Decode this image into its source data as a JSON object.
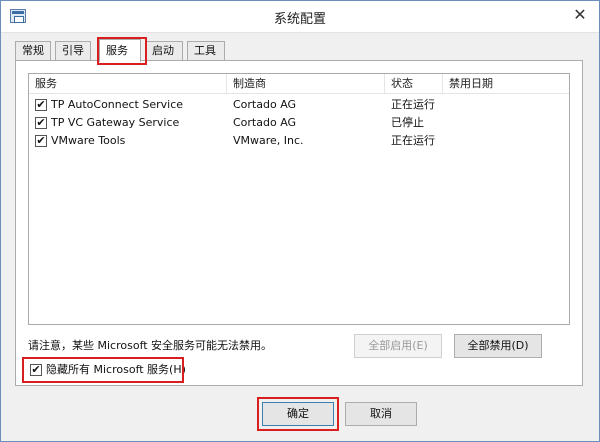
{
  "window": {
    "title": "系统配置"
  },
  "tabs": [
    {
      "label": "常规",
      "active": false
    },
    {
      "label": "引导",
      "active": false
    },
    {
      "label": "服务",
      "active": true
    },
    {
      "label": "启动",
      "active": false
    },
    {
      "label": "工具",
      "active": false
    }
  ],
  "services": {
    "columns": [
      "服务",
      "制造商",
      "状态",
      "禁用日期"
    ],
    "rows": [
      {
        "checked": true,
        "service": "TP AutoConnect Service",
        "manufacturer": "Cortado AG",
        "status": "正在运行",
        "disabled_date": ""
      },
      {
        "checked": true,
        "service": "TP VC Gateway Service",
        "manufacturer": "Cortado AG",
        "status": "已停止",
        "disabled_date": ""
      },
      {
        "checked": true,
        "service": "VMware Tools",
        "manufacturer": "VMware, Inc.",
        "status": "正在运行",
        "disabled_date": ""
      }
    ]
  },
  "note": "请注意，某些 Microsoft 安全服务可能无法禁用。",
  "buttons": {
    "enable_all": "全部启用(E)",
    "disable_all": "全部禁用(D)",
    "ok": "确定",
    "cancel": "取消"
  },
  "hide_ms": {
    "label": "隐藏所有 Microsoft 服务(H)",
    "checked": true
  },
  "icons": {
    "check_mark": "✔",
    "close": "✕"
  },
  "colors": {
    "highlight": "#d81e1e"
  }
}
